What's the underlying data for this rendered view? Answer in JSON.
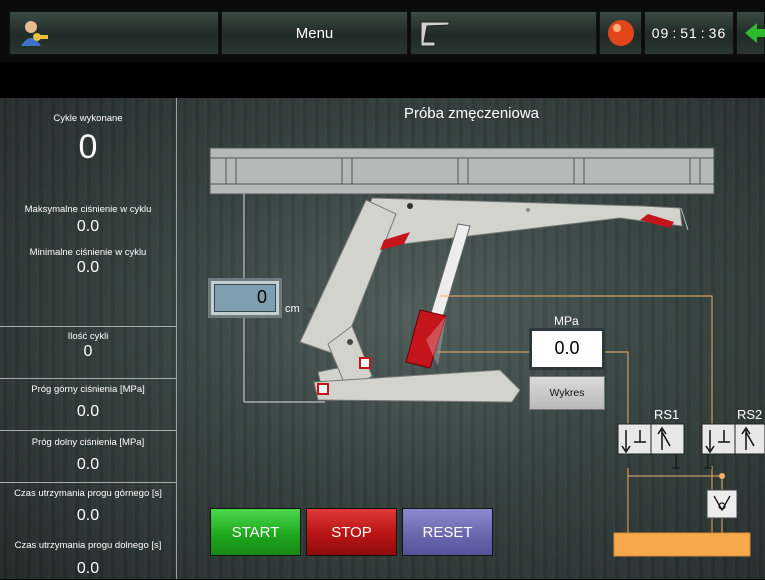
{
  "header": {
    "menu_label": "Menu",
    "time_h": "09",
    "time_m": "51",
    "time_s": "36"
  },
  "left_panel": {
    "cycles_done_label": "Cykle wykonane",
    "cycles_done_value": "0",
    "max_pressure_label": "Maksymalne ciśnienie w cyklu",
    "max_pressure_value": "0.0",
    "min_pressure_label": "Minimalne ciśnienie w cyklu",
    "min_pressure_value": "0.0",
    "cycle_count_label": "Ilość cykli",
    "cycle_count_value": "0",
    "upper_threshold_label": "Próg górny ciśnienia [MPa]",
    "upper_threshold_value": "0.0",
    "lower_threshold_label": "Próg dolny ciśnienia [MPa]",
    "lower_threshold_value": "0.0",
    "upper_hold_label": "Czas utrzymania progu górnego [s]",
    "upper_hold_value": "0.0",
    "lower_hold_label": "Czas utrzymania progu dolnego [s]",
    "lower_hold_value": "0.0"
  },
  "main": {
    "title": "Próba zmęczeniowa",
    "distance_value": "0",
    "distance_unit": "cm",
    "pressure_unit": "MPa",
    "pressure_value": "0.0",
    "chart_button": "Wykres",
    "valve1_label": "RS1",
    "valve2_label": "RS2"
  },
  "controls": {
    "start_label": "START",
    "stop_label": "STOP",
    "reset_label": "RESET"
  },
  "colors": {
    "start": "#1fb81f",
    "stop": "#c41818",
    "reset": "#6c6ab0",
    "tank": "#f7a94c",
    "hydraulic_line": "#f0b069",
    "cylinder": "#c4141c"
  }
}
